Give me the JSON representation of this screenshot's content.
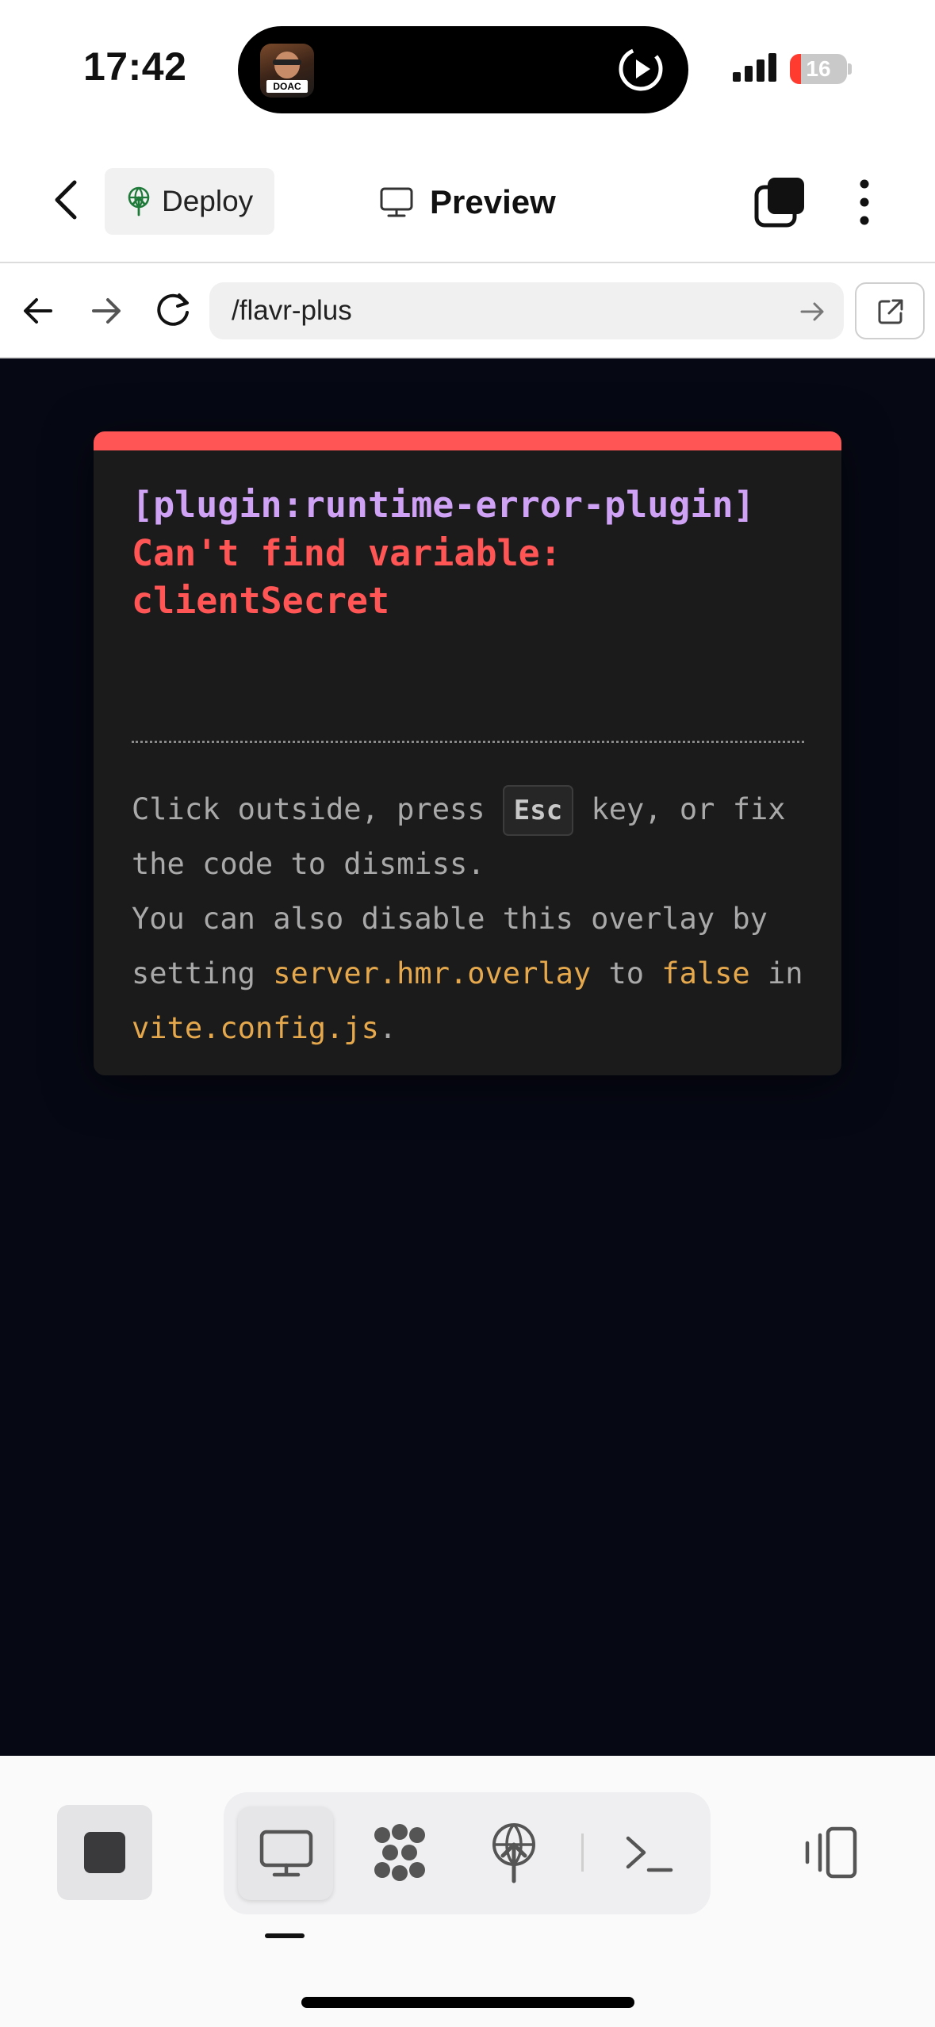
{
  "status_bar": {
    "time": "17:42",
    "now_playing_badge": "DOAC",
    "battery_level": "16",
    "icons": [
      "play-icon",
      "cellular-signal-icon",
      "battery-icon"
    ]
  },
  "header": {
    "deploy_label": "Deploy",
    "preview_label": "Preview",
    "icons": [
      "chevron-left-icon",
      "deploy-icon",
      "monitor-icon",
      "tabs-icon",
      "more-vertical-icon"
    ]
  },
  "url_bar": {
    "path": "/flavr-plus",
    "icons": [
      "arrow-left-icon",
      "arrow-right-icon",
      "reload-icon",
      "go-arrow-icon",
      "external-link-icon"
    ]
  },
  "error_overlay": {
    "plugin": "[plugin:runtime-error-plugin]",
    "message": "Can't find variable:\nclientSecret",
    "tip_part1": "Click outside, press ",
    "tip_key": "Esc",
    "tip_part2": " key, or fix the code to dismiss.",
    "tip_part3": "You can also disable this overlay by setting ",
    "tip_code1": "server.hmr.overlay",
    "tip_part4": " to ",
    "tip_code2": "false",
    "tip_part5": " in ",
    "tip_code3": "vite.config.js",
    "tip_part6": ".",
    "colors": {
      "accent_bar": "#ff5555",
      "plugin": "#cfa2f6",
      "message": "#ff5555",
      "code": "#e5a84c"
    }
  },
  "bottom_bar": {
    "icons": [
      "stop-icon",
      "monitor-icon",
      "cluster-icon",
      "deploy-icon",
      "terminal-icon",
      "panel-toggle-icon"
    ],
    "active_tab": "preview"
  }
}
